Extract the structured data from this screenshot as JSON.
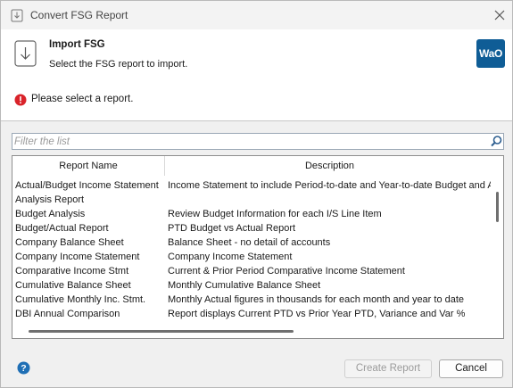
{
  "window": {
    "title": "Convert FSG Report",
    "close_icon": "close-icon"
  },
  "header": {
    "title": "Import FSG",
    "subtitle": "Select the FSG report to import.",
    "logo_text": "WaO",
    "logo_color": "#0f5d96"
  },
  "error": {
    "message": "Please select a report.",
    "color": "#d9232a"
  },
  "filter": {
    "placeholder": "Filter the list",
    "value": ""
  },
  "list": {
    "columns": [
      "Report Name",
      "Description"
    ],
    "rows": [
      {
        "name": "Actual/Budget Income Statement",
        "description": "Income Statement to include Period-to-date and Year-to-date Budget and A"
      },
      {
        "name": "Analysis Report",
        "description": ""
      },
      {
        "name": "Budget Analysis",
        "description": "Review Budget Information for each I/S Line Item"
      },
      {
        "name": "Budget/Actual Report",
        "description": "PTD Budget vs Actual Report"
      },
      {
        "name": "Company Balance Sheet",
        "description": "Balance Sheet - no detail of accounts"
      },
      {
        "name": "Company Income Statement",
        "description": "Company Income Statement"
      },
      {
        "name": "Comparative Income Stmt",
        "description": "Current & Prior Period Comparative Income Statement"
      },
      {
        "name": "Cumulative Balance Sheet",
        "description": "Monthly Cumulative Balance Sheet"
      },
      {
        "name": "Cumulative Monthly Inc. Stmt.",
        "description": "Monthly Actual figures in thousands for each month and year to date"
      },
      {
        "name": "DBI Annual Comparison",
        "description": "Report displays Current PTD vs Prior Year PTD, Variance and Var %"
      }
    ]
  },
  "footer": {
    "create_label": "Create Report",
    "create_enabled": false,
    "cancel_label": "Cancel",
    "help_color": "#1f6fb5"
  }
}
